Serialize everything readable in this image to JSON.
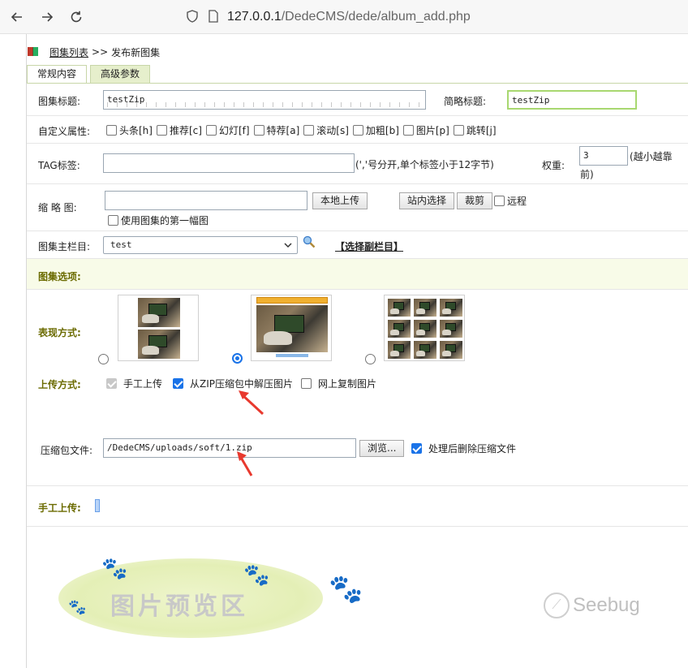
{
  "browser": {
    "url_host": "127.0.0.1",
    "url_path": "/DedeCMS/dede/album_add.php",
    "back_icon": "back-arrow-icon",
    "forward_icon": "forward-arrow-icon",
    "reload_icon": "reload-icon"
  },
  "breadcrumb": {
    "link": "图集列表",
    "separator": ">>",
    "current": "发布新图集"
  },
  "tabs": [
    {
      "label": "常规内容",
      "active": false
    },
    {
      "label": "高级参数",
      "active": true
    }
  ],
  "form": {
    "title_label": "图集标题:",
    "title_value": "testZip",
    "short_title_label": "简略标题:",
    "short_title_value": "testZip",
    "attr_label": "自定义属性:",
    "attrs": [
      "头条[h]",
      "推荐[c]",
      "幻灯[f]",
      "特荐[a]",
      "滚动[s]",
      "加粗[b]",
      "图片[p]",
      "跳转[j]"
    ],
    "tag_label": "TAG标签:",
    "tag_value": "",
    "tag_hint": "(','号分开,单个标签小于12字节)",
    "weight_label": "权重:",
    "weight_value": "3",
    "weight_hint_1": "(越小越靠",
    "weight_hint_2": "前)",
    "thumb_label": "缩 略 图:",
    "thumb_value": "",
    "local_upload_btn": "本地上传",
    "site_select_btn": "站内选择",
    "crop_btn": "裁剪",
    "remote_label": "远程",
    "use_first_label": "使用图集的第一幅图",
    "column_label": "图集主栏目:",
    "column_value": "test",
    "sub_column_link": "【选择副栏目】"
  },
  "album_options": {
    "section_title": "图集选项:",
    "display_label": "表现方式:",
    "upload_label": "上传方式:",
    "upload_options": [
      {
        "label": "手工上传",
        "state": "disabled-checked"
      },
      {
        "label": "从ZIP压缩包中解压图片",
        "state": "checked"
      },
      {
        "label": "网上复制图片",
        "state": "unchecked"
      }
    ],
    "zip_label": "压缩包文件:",
    "zip_value": "/DedeCMS/uploads/soft/1.zip",
    "browse_btn": "浏览...",
    "delete_after_label": "处理后删除压缩文件",
    "manual_upload_label": "手工上传:",
    "preview_text": "图片预览区"
  },
  "watermark": "Seebug",
  "colors": {
    "accent": "#1a73e8",
    "section_title": "#6b6b00",
    "arrow": "#e8392e",
    "tab_active": "#e6efcc"
  }
}
